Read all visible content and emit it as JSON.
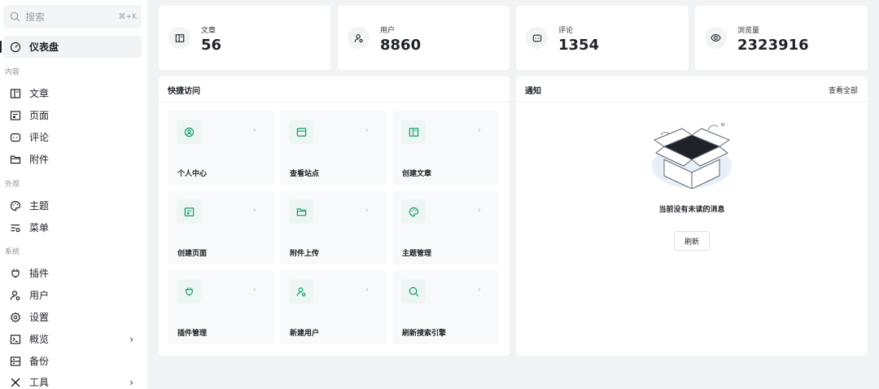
{
  "search": {
    "placeholder": "搜索",
    "shortcut": "⌘+K"
  },
  "sidebar": {
    "dashboard": "仪表盘",
    "group_content": "内容",
    "posts": "文章",
    "pages": "页面",
    "comments": "评论",
    "attachments": "附件",
    "group_appearance": "外观",
    "themes": "主题",
    "menus": "菜单",
    "group_system": "系统",
    "plugins": "插件",
    "users": "用户",
    "settings": "设置",
    "overview": "概览",
    "backup": "备份",
    "tools": "工具",
    "chevron": "›"
  },
  "stats": [
    {
      "label": "文章",
      "value": "56",
      "icon": "document-icon"
    },
    {
      "label": "用户",
      "value": "8860",
      "icon": "user-icon"
    },
    {
      "label": "评论",
      "value": "1354",
      "icon": "comment-icon"
    },
    {
      "label": "浏览量",
      "value": "2323916",
      "icon": "eye-icon"
    }
  ],
  "quick_access": {
    "title": "快捷访问",
    "chevron": "›",
    "items": [
      {
        "label": "个人中心",
        "icon": "user-circle-icon"
      },
      {
        "label": "查看站点",
        "icon": "browser-icon"
      },
      {
        "label": "创建文章",
        "icon": "document-icon"
      },
      {
        "label": "创建页面",
        "icon": "page-icon"
      },
      {
        "label": "附件上传",
        "icon": "folder-icon"
      },
      {
        "label": "主题管理",
        "icon": "palette-icon"
      },
      {
        "label": "插件管理",
        "icon": "plug-icon"
      },
      {
        "label": "新建用户",
        "icon": "user-add-icon"
      },
      {
        "label": "刷新搜索引擎",
        "icon": "search-refresh-icon"
      }
    ]
  },
  "notifications": {
    "title": "通知",
    "view_all": "查看全部",
    "empty_message": "当前没有未读的消息",
    "refresh_label": "刷新"
  },
  "colors": {
    "accent": "#0f9b72",
    "accent_bg": "#eef6f3"
  }
}
